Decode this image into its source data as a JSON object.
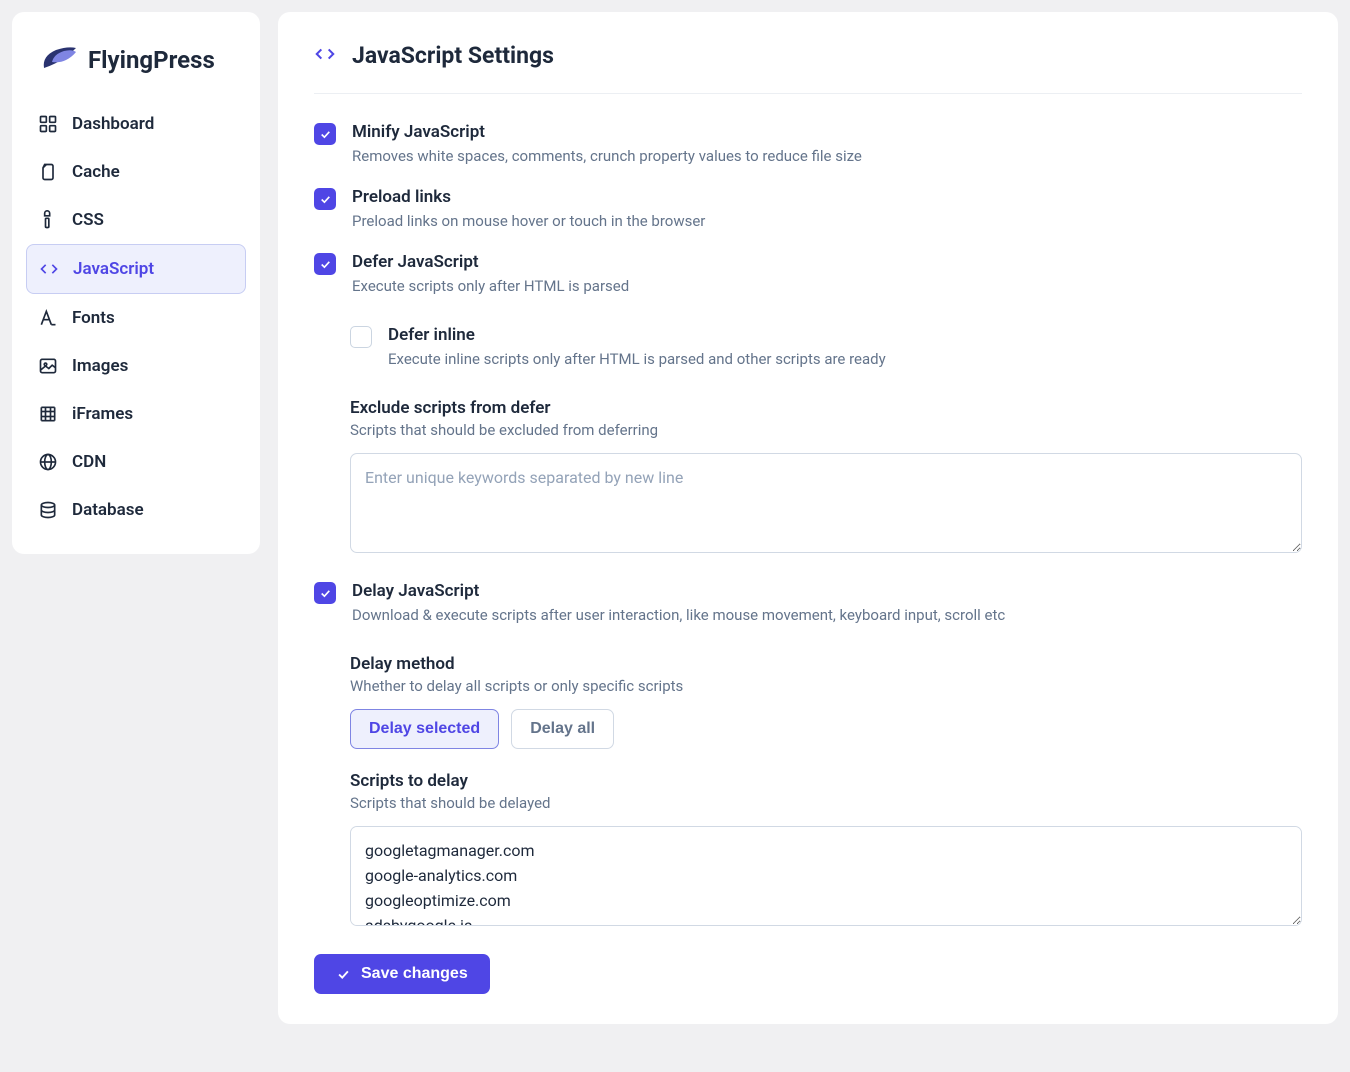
{
  "brand": "FlyingPress",
  "sidebar": {
    "items": [
      {
        "label": "Dashboard",
        "icon": "dashboard-icon"
      },
      {
        "label": "Cache",
        "icon": "cache-icon"
      },
      {
        "label": "CSS",
        "icon": "css-icon"
      },
      {
        "label": "JavaScript",
        "icon": "code-icon",
        "active": true
      },
      {
        "label": "Fonts",
        "icon": "fonts-icon"
      },
      {
        "label": "Images",
        "icon": "images-icon"
      },
      {
        "label": "iFrames",
        "icon": "iframes-icon"
      },
      {
        "label": "CDN",
        "icon": "cdn-icon"
      },
      {
        "label": "Database",
        "icon": "database-icon"
      }
    ]
  },
  "page": {
    "title": "JavaScript Settings"
  },
  "settings": {
    "minify": {
      "label": "Minify JavaScript",
      "desc": "Removes white spaces, comments, crunch property values to reduce file size",
      "checked": true
    },
    "preload": {
      "label": "Preload links",
      "desc": "Preload links on mouse hover or touch in the browser",
      "checked": true
    },
    "defer": {
      "label": "Defer JavaScript",
      "desc": "Execute scripts only after HTML is parsed",
      "checked": true
    },
    "defer_inline": {
      "label": "Defer inline",
      "desc": "Execute inline scripts only after HTML is parsed and other scripts are ready",
      "checked": false
    },
    "exclude_defer": {
      "label": "Exclude scripts from defer",
      "desc": "Scripts that should be excluded from deferring",
      "placeholder": "Enter unique keywords separated by new line",
      "value": ""
    },
    "delay": {
      "label": "Delay JavaScript",
      "desc": "Download & execute scripts after user interaction, like mouse movement, keyboard input, scroll etc",
      "checked": true
    },
    "delay_method": {
      "label": "Delay method",
      "desc": "Whether to delay all scripts or only specific scripts",
      "options": [
        "Delay selected",
        "Delay all"
      ],
      "selected": "Delay selected"
    },
    "scripts_to_delay": {
      "label": "Scripts to delay",
      "desc": "Scripts that should be delayed",
      "value": "googletagmanager.com\ngoogle-analytics.com\ngoogleoptimize.com\nadsbygoogle.js"
    }
  },
  "actions": {
    "save": "Save changes"
  }
}
